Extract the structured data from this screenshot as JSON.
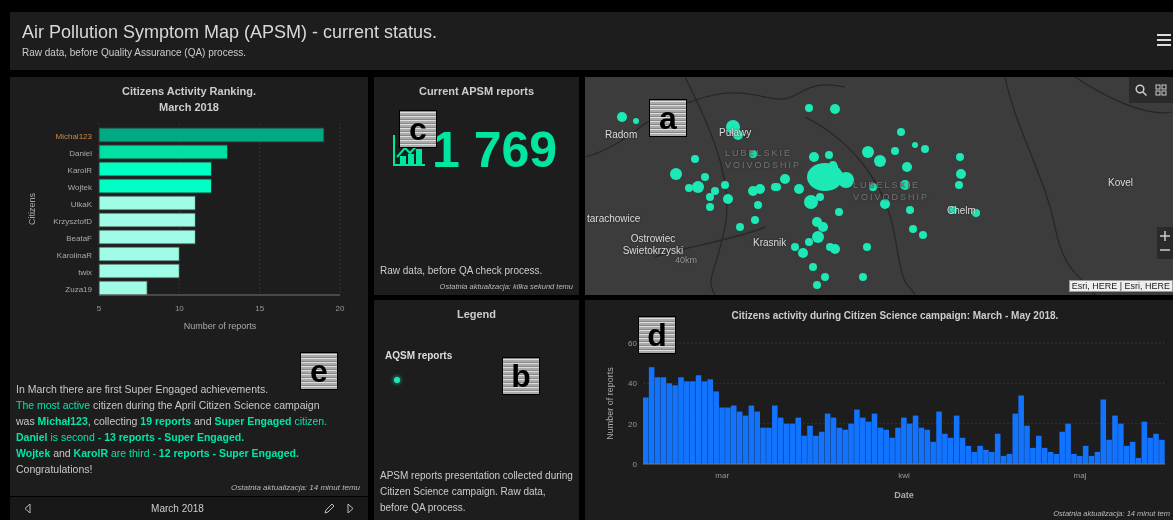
{
  "header": {
    "title": "Air Pollution Symptom Map (APSM) - current status.",
    "subtitle": "Raw data, before Quality Assurance (QA) process."
  },
  "ranking": {
    "title": "Citizens Activity Ranking.",
    "subtitle": "March 2018",
    "annotation": "e",
    "chart_data": {
      "type": "bar",
      "orientation": "horizontal",
      "xlabel": "Number of reports",
      "ylabel": "Citizens",
      "categories": [
        "Michal123",
        "Daniel",
        "KarolR",
        "Wojtek",
        "UlkaK",
        "KrzysztofD",
        "BeataF",
        "KarolinaR",
        "twix",
        "Zuza19"
      ],
      "series": [
        {
          "values": [
            19,
            13,
            12,
            12,
            11,
            11,
            11,
            10,
            10,
            8
          ]
        }
      ],
      "colors": [
        "#00a884",
        "#00e0a0",
        "#00ffc5",
        "#00ffc5",
        "#a0fce6",
        "#a0fce6",
        "#a0fce6",
        "#a0fce6",
        "#a0fce6",
        "#a0fce6"
      ],
      "xlim": [
        5,
        20
      ],
      "xticks": [
        5,
        10,
        15,
        20
      ]
    },
    "summary": [
      [
        {
          "text": "In March there are first Super Engaged achievements.",
          "accent": false
        }
      ],
      [
        {
          "text": "The most active",
          "accent": true
        },
        {
          "text": " citizen during the April Citizen Science campaign",
          "accent": false
        }
      ],
      [
        {
          "text": "was ",
          "accent": false
        },
        {
          "text": "**Michał123**",
          "accent": true
        },
        {
          "text": ", collecting ",
          "accent": false
        },
        {
          "text": "**19 reports**",
          "accent": true
        },
        {
          "text": "  and ",
          "accent": false
        },
        {
          "text": "**Super Engaged** citizen.",
          "accent": true
        }
      ],
      [
        {
          "text": "**Daniel** is second - **13 reports - Super Engaged.**",
          "accent": true
        }
      ],
      [
        {
          "text": "**Wojtek**",
          "accent": true
        },
        {
          "text": " and ",
          "accent": false
        },
        {
          "text": "**KarolR**",
          "accent": true
        },
        {
          "text": " are third - **12 reports - Super Engaged.**",
          "accent": true
        }
      ],
      [
        {
          "text": "Congratulations!",
          "accent": false
        }
      ]
    ],
    "updated": "Ostatnia aktualizacja: 14 minut temu",
    "nav": {
      "label": "March 2018"
    }
  },
  "counter": {
    "title": "Current APSM reports",
    "annotation": "c",
    "value": "1 769",
    "note": "Raw data, before QA check process.",
    "updated": "Ostatnia aktualizacja: kilka sekund temu"
  },
  "legend": {
    "title": "Legend",
    "annotation": "b",
    "layer": "AQSM reports",
    "color": "#1de9b6",
    "description": "APSM reports presentation collected during Citizen Science campaign. Raw data, before QA process."
  },
  "map": {
    "annotation": "a",
    "labels": [
      {
        "text": "Radom",
        "kind": "city"
      },
      {
        "text": "Pulawy",
        "kind": "city"
      },
      {
        "text": "LUBELSKIE VOIVODSHIP",
        "kind": "region"
      },
      {
        "text": "LUBELSKIE VOIVODSHIP",
        "kind": "region"
      },
      {
        "text": "Chelm",
        "kind": "city"
      },
      {
        "text": "Kovel",
        "kind": "city"
      },
      {
        "text": "tarachowice",
        "kind": "city"
      },
      {
        "text": "Ostrowiec Swietokrzyski",
        "kind": "city"
      },
      {
        "text": "Krasnik",
        "kind": "city"
      },
      {
        "text": "40km",
        "kind": "scale"
      }
    ],
    "attribution": "Esri, HERE | Esri, HERE"
  },
  "activity": {
    "annotation": "d",
    "month_labels": [
      "mar",
      "kwi",
      "maj"
    ],
    "updated": "Ostatnia aktualizacja: 14 minut tem",
    "chart_data": {
      "type": "bar",
      "title": "Citizens activity during Citizen Science campaign: March - May 2018.",
      "xlabel": "Date",
      "ylabel": "Number of reports",
      "ylim": [
        0,
        60
      ],
      "yticks": [
        0,
        20,
        40,
        60
      ],
      "series": [
        {
          "color": "#1273ff",
          "values": [
            33,
            48,
            43,
            43,
            40,
            39,
            43,
            41,
            41,
            44,
            41,
            42,
            36,
            28,
            28,
            29,
            26,
            24,
            29,
            26,
            18,
            18,
            29,
            23,
            20,
            20,
            23,
            14,
            19,
            14,
            16,
            25,
            23,
            18,
            17,
            20,
            27,
            23,
            21,
            25,
            18,
            17,
            13,
            18,
            23,
            20,
            24,
            18,
            17,
            11,
            26,
            15,
            13,
            24,
            13,
            9,
            6,
            9,
            7,
            6,
            15,
            4,
            5,
            25,
            34,
            19,
            8,
            14,
            8,
            6,
            5,
            16,
            20,
            5,
            4,
            9,
            4,
            6,
            32,
            12,
            24,
            20,
            9,
            11,
            3,
            21,
            13,
            15,
            12
          ]
        }
      ]
    }
  }
}
